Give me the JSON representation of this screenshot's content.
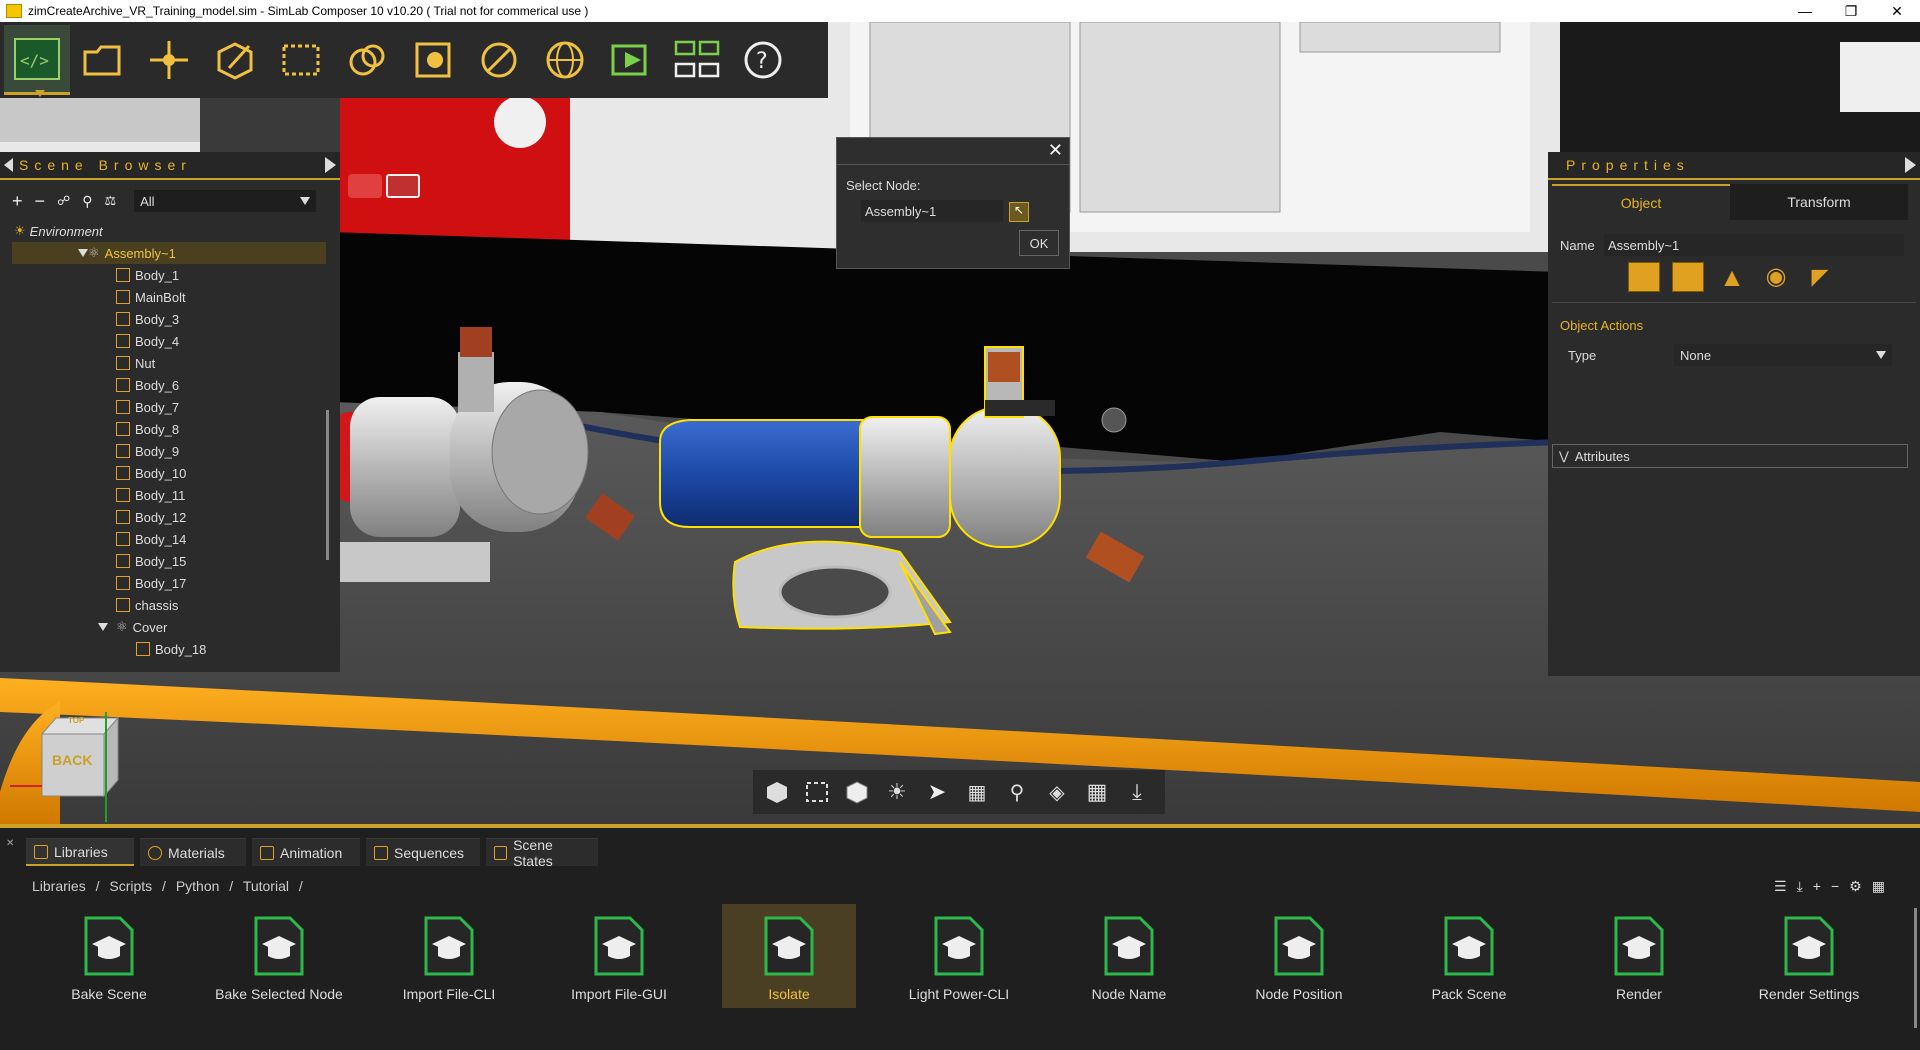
{
  "window": {
    "title": "zimCreateArchive_VR_Training_model.sim - SimLab Composer 10 v10.20 ( Trial not for commerical use )",
    "controls": [
      "minimize-icon",
      "maximize-icon",
      "close-icon"
    ]
  },
  "toolbar": {
    "items": [
      {
        "name": "script-editor",
        "icon": "code-window-icon",
        "active": true
      },
      {
        "name": "open-file",
        "icon": "folder-icon"
      },
      {
        "name": "transform",
        "icon": "move-arrows-icon"
      },
      {
        "name": "edit",
        "icon": "cube-pencil-icon"
      },
      {
        "name": "selection",
        "icon": "selection-box-icon"
      },
      {
        "name": "materials",
        "icon": "material-balls-icon"
      },
      {
        "name": "scene-states",
        "icon": "frame-sphere-icon"
      },
      {
        "name": "measure",
        "icon": "circle-slash-icon"
      },
      {
        "name": "environment",
        "icon": "globe-icon"
      },
      {
        "name": "animation",
        "icon": "play-film-icon"
      },
      {
        "name": "flow",
        "icon": "flowchart-icon"
      },
      {
        "name": "help",
        "icon": "question-icon"
      }
    ]
  },
  "scene_browser": {
    "title": "Scene Browser",
    "filter": "All",
    "root": "Environment",
    "assembly": "Assembly~1",
    "bodies": [
      "Body_1",
      "MainBolt",
      "Body_3",
      "Body_4",
      "Nut",
      "Body_6",
      "Body_7",
      "Body_8",
      "Body_9",
      "Body_10",
      "Body_11",
      "Body_12",
      "Body_14",
      "Body_15",
      "Body_17",
      "chassis"
    ],
    "cover": "Cover",
    "cover_child": "Body_18"
  },
  "dialog": {
    "label": "Select Node:",
    "value": "Assembly~1",
    "ok": "OK"
  },
  "properties": {
    "title": "Properties",
    "tabs": [
      "Object",
      "Transform"
    ],
    "name_label": "Name",
    "name_value": "Assembly~1",
    "object_actions": "Object Actions",
    "type_label": "Type",
    "type_value": "None",
    "attributes": "Attributes"
  },
  "viewcube": {
    "label": "BACK",
    "top": "TOP"
  },
  "bottom": {
    "tabs": [
      {
        "label": "Libraries",
        "icon": "books-icon",
        "active": true
      },
      {
        "label": "Materials",
        "icon": "material-icon"
      },
      {
        "label": "Animation",
        "icon": "animation-icon"
      },
      {
        "label": "Sequences",
        "icon": "sequence-icon"
      },
      {
        "label": "Scene States",
        "icon": "scene-state-icon"
      }
    ],
    "breadcrumb": "Libraries / Scripts / Python / Tutorial /",
    "libraries": [
      "Bake Scene",
      "Bake Selected Node",
      "Import File-CLI",
      "Import File-GUI",
      "Isolate",
      "Light Power-CLI",
      "Node Name",
      "Node Position",
      "Pack Scene",
      "Render",
      "Render Settings"
    ],
    "selected": "Isolate"
  },
  "colors": {
    "accent": "#c9a227",
    "highlight": "#f0c040",
    "panel": "#2b2b2b"
  }
}
